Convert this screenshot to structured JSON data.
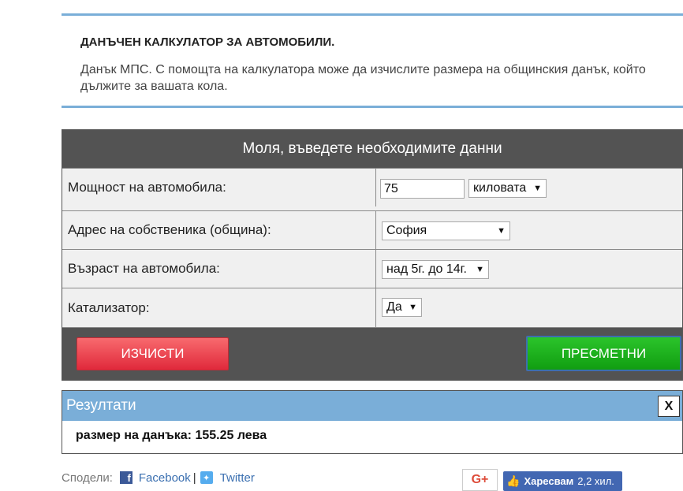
{
  "intro": {
    "title": "ДАНЪЧЕН КАЛКУЛАТОР ЗА АВТОМОБИЛИ.",
    "text": "Данък МПС. С помощта на калкулатора може да изчислите размера на общинския данък, който дължите за вашата кола."
  },
  "form": {
    "header": "Моля, въведете необходимите данни",
    "power": {
      "label": "Мощност на автомобила:",
      "value": "75",
      "unit": "киловата"
    },
    "address": {
      "label": "Адрес на собственика (община):",
      "value": "София"
    },
    "age": {
      "label": "Възраст на автомобила:",
      "value": "над 5г. до 14г."
    },
    "catalyst": {
      "label": "Катализатор:",
      "value": "Да"
    },
    "clear_label": "ИЗЧИСТИ",
    "calculate_label": "ПРЕСМЕТНИ"
  },
  "results": {
    "header": "Резултати",
    "close_label": "X",
    "text": "размер на данъка: 155.25 лева"
  },
  "share": {
    "label": "Сподели:",
    "facebook": "Facebook",
    "separator": "|",
    "twitter": "Twitter",
    "gplus": "G+",
    "like_label": "Харесвам",
    "like_count": "2,2 хил."
  },
  "colors": {
    "accent_blue": "#7aaed8",
    "header_gray": "#535353",
    "clear_red": "#e0293b",
    "calc_green": "#119e11"
  }
}
